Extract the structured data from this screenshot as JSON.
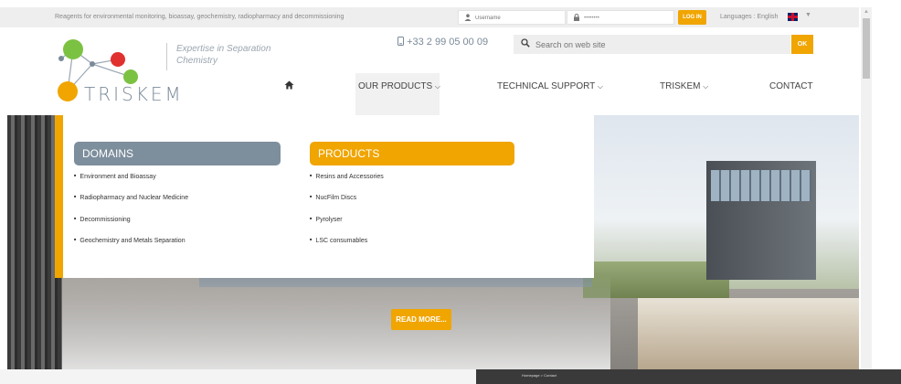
{
  "topbar": {
    "tagline": "Reagents for environmental monitoring, bioassay, geochemistry, radiopharmacy and decommissioning",
    "username_placeholder": "Username",
    "password_value": "••••••••",
    "login_label": "LOG IN",
    "languages_label": "Languages : English"
  },
  "header": {
    "logo_text": "TRISKEM",
    "tagline": "Expertise in Separation Chemistry",
    "phone": "+33 2 99 05 00 09",
    "search_placeholder": "Search on web site",
    "search_button": "OK"
  },
  "nav": {
    "items": [
      {
        "label": "OUR PRODUCTS",
        "has_caret": true
      },
      {
        "label": "TECHNICAL SUPPORT",
        "has_caret": true
      },
      {
        "label": "TRISKEM",
        "has_caret": true
      },
      {
        "label": "CONTACT",
        "has_caret": false
      }
    ]
  },
  "mega_menu": {
    "domains": {
      "title": "DOMAINS",
      "items": [
        "Environment and Bioassay",
        "Radiopharmacy and Nuclear Medicine",
        "Decommissioning",
        "Geochemistry and Metals Separation"
      ]
    },
    "products": {
      "title": "PRODUCTS",
      "items": [
        "Resins and Accessories",
        "NucFilm Discs",
        "Pyrolyser",
        "LSC consumables"
      ]
    }
  },
  "hero": {
    "button_label": "READ MORE..."
  },
  "breadcrumb": "Homepage > Contact",
  "colors": {
    "accent": "#f0a500",
    "domains_header": "#7d8e9d",
    "text": "#444444",
    "logo_green": "#7cc242",
    "logo_red": "#e0312f",
    "logo_orange": "#f0a500",
    "logo_gray": "#7a8a99"
  }
}
